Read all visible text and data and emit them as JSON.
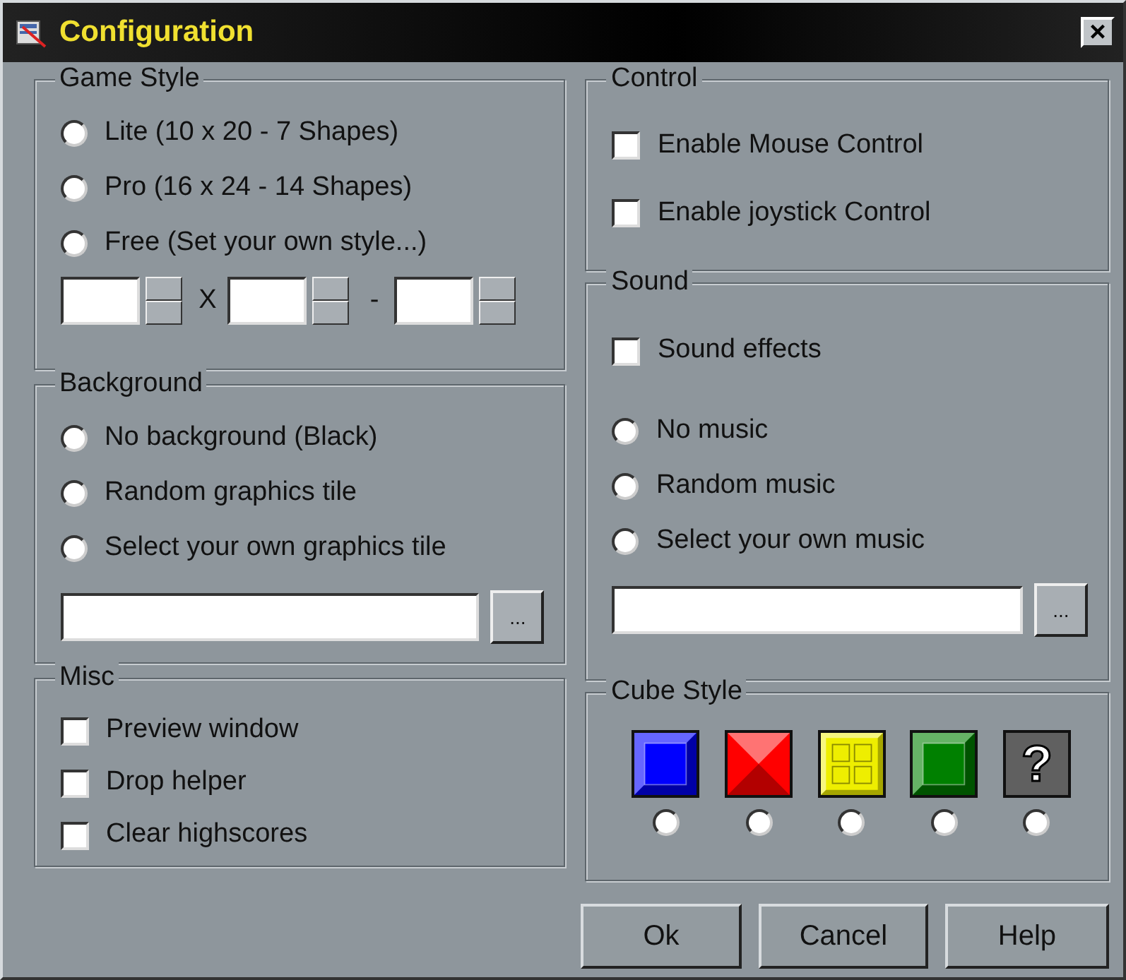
{
  "window": {
    "title": "Configuration",
    "close_symbol": "×"
  },
  "game_style": {
    "title": "Game Style",
    "options": [
      {
        "label": "Lite (10 x 20 - 7 Shapes)",
        "selected": false
      },
      {
        "label": "Pro (16 x 24 - 14 Shapes)",
        "selected": false
      },
      {
        "label": "Free (Set your own style...)",
        "selected": false
      }
    ],
    "separators": [
      "X",
      "-"
    ]
  },
  "background": {
    "title": "Background",
    "options": [
      {
        "label": "No background (Black)",
        "selected": false
      },
      {
        "label": "Random graphics tile",
        "selected": false
      },
      {
        "label": "Select your own graphics tile",
        "selected": false
      }
    ],
    "browse": "..."
  },
  "misc": {
    "title": "Misc",
    "items": [
      {
        "label": "Preview window",
        "checked": false
      },
      {
        "label": "Drop helper",
        "checked": false
      },
      {
        "label": "Clear highscores",
        "checked": false
      }
    ]
  },
  "control": {
    "title": "Control",
    "items": [
      {
        "label": "Enable Mouse Control",
        "checked": false
      },
      {
        "label": "Enable joystick Control",
        "checked": false
      }
    ]
  },
  "sound": {
    "title": "Sound",
    "effects": {
      "label": "Sound effects",
      "checked": false
    },
    "options": [
      {
        "label": "No music",
        "selected": false
      },
      {
        "label": "Random music",
        "selected": false
      },
      {
        "label": "Select your own music",
        "selected": false
      }
    ],
    "browse": "..."
  },
  "cube_style": {
    "title": "Cube Style",
    "cubes": [
      {
        "kind": "framed",
        "color": "#0000ff",
        "selected": false
      },
      {
        "kind": "pyramid",
        "color": "#ff0000",
        "selected": false
      },
      {
        "kind": "grid",
        "color": "#eeee00",
        "selected": false
      },
      {
        "kind": "framed",
        "color": "#008000",
        "selected": false
      },
      {
        "kind": "question",
        "color": "#606060",
        "symbol": "?",
        "selected": false
      }
    ]
  },
  "buttons": [
    "Ok",
    "Cancel",
    "Help"
  ]
}
